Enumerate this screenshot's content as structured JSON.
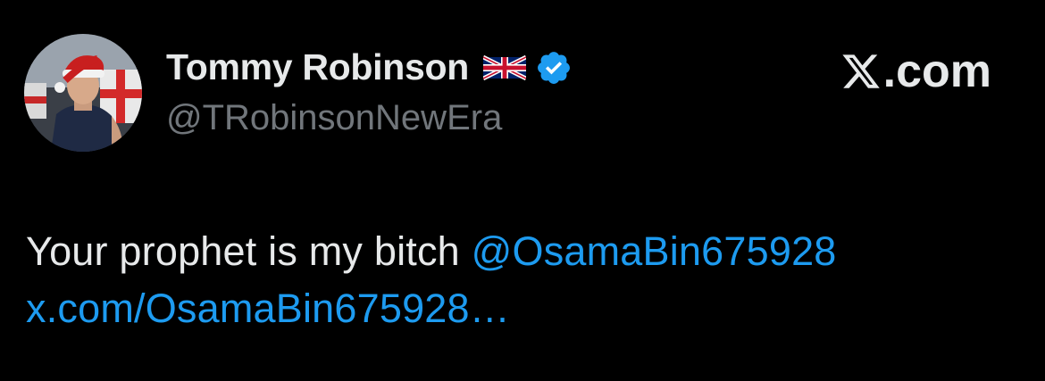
{
  "author": {
    "display_name": "Tommy Robinson",
    "handle": "@TRobinsonNewEra",
    "flag_icon": "uk-flag-icon",
    "verified_icon": "verified-badge-icon",
    "verified_color": "#1d9bf0"
  },
  "brand": {
    "label": ".com",
    "icon": "x-logo-icon"
  },
  "tweet": {
    "text": "Your prophet is my bitch",
    "mention": "@OsamaBin675928",
    "link": "x.com/OsamaBin675928…"
  },
  "colors": {
    "background": "#000000",
    "primary_text": "#e7e9ea",
    "secondary_text": "#71767b",
    "accent": "#1d9bf0"
  }
}
